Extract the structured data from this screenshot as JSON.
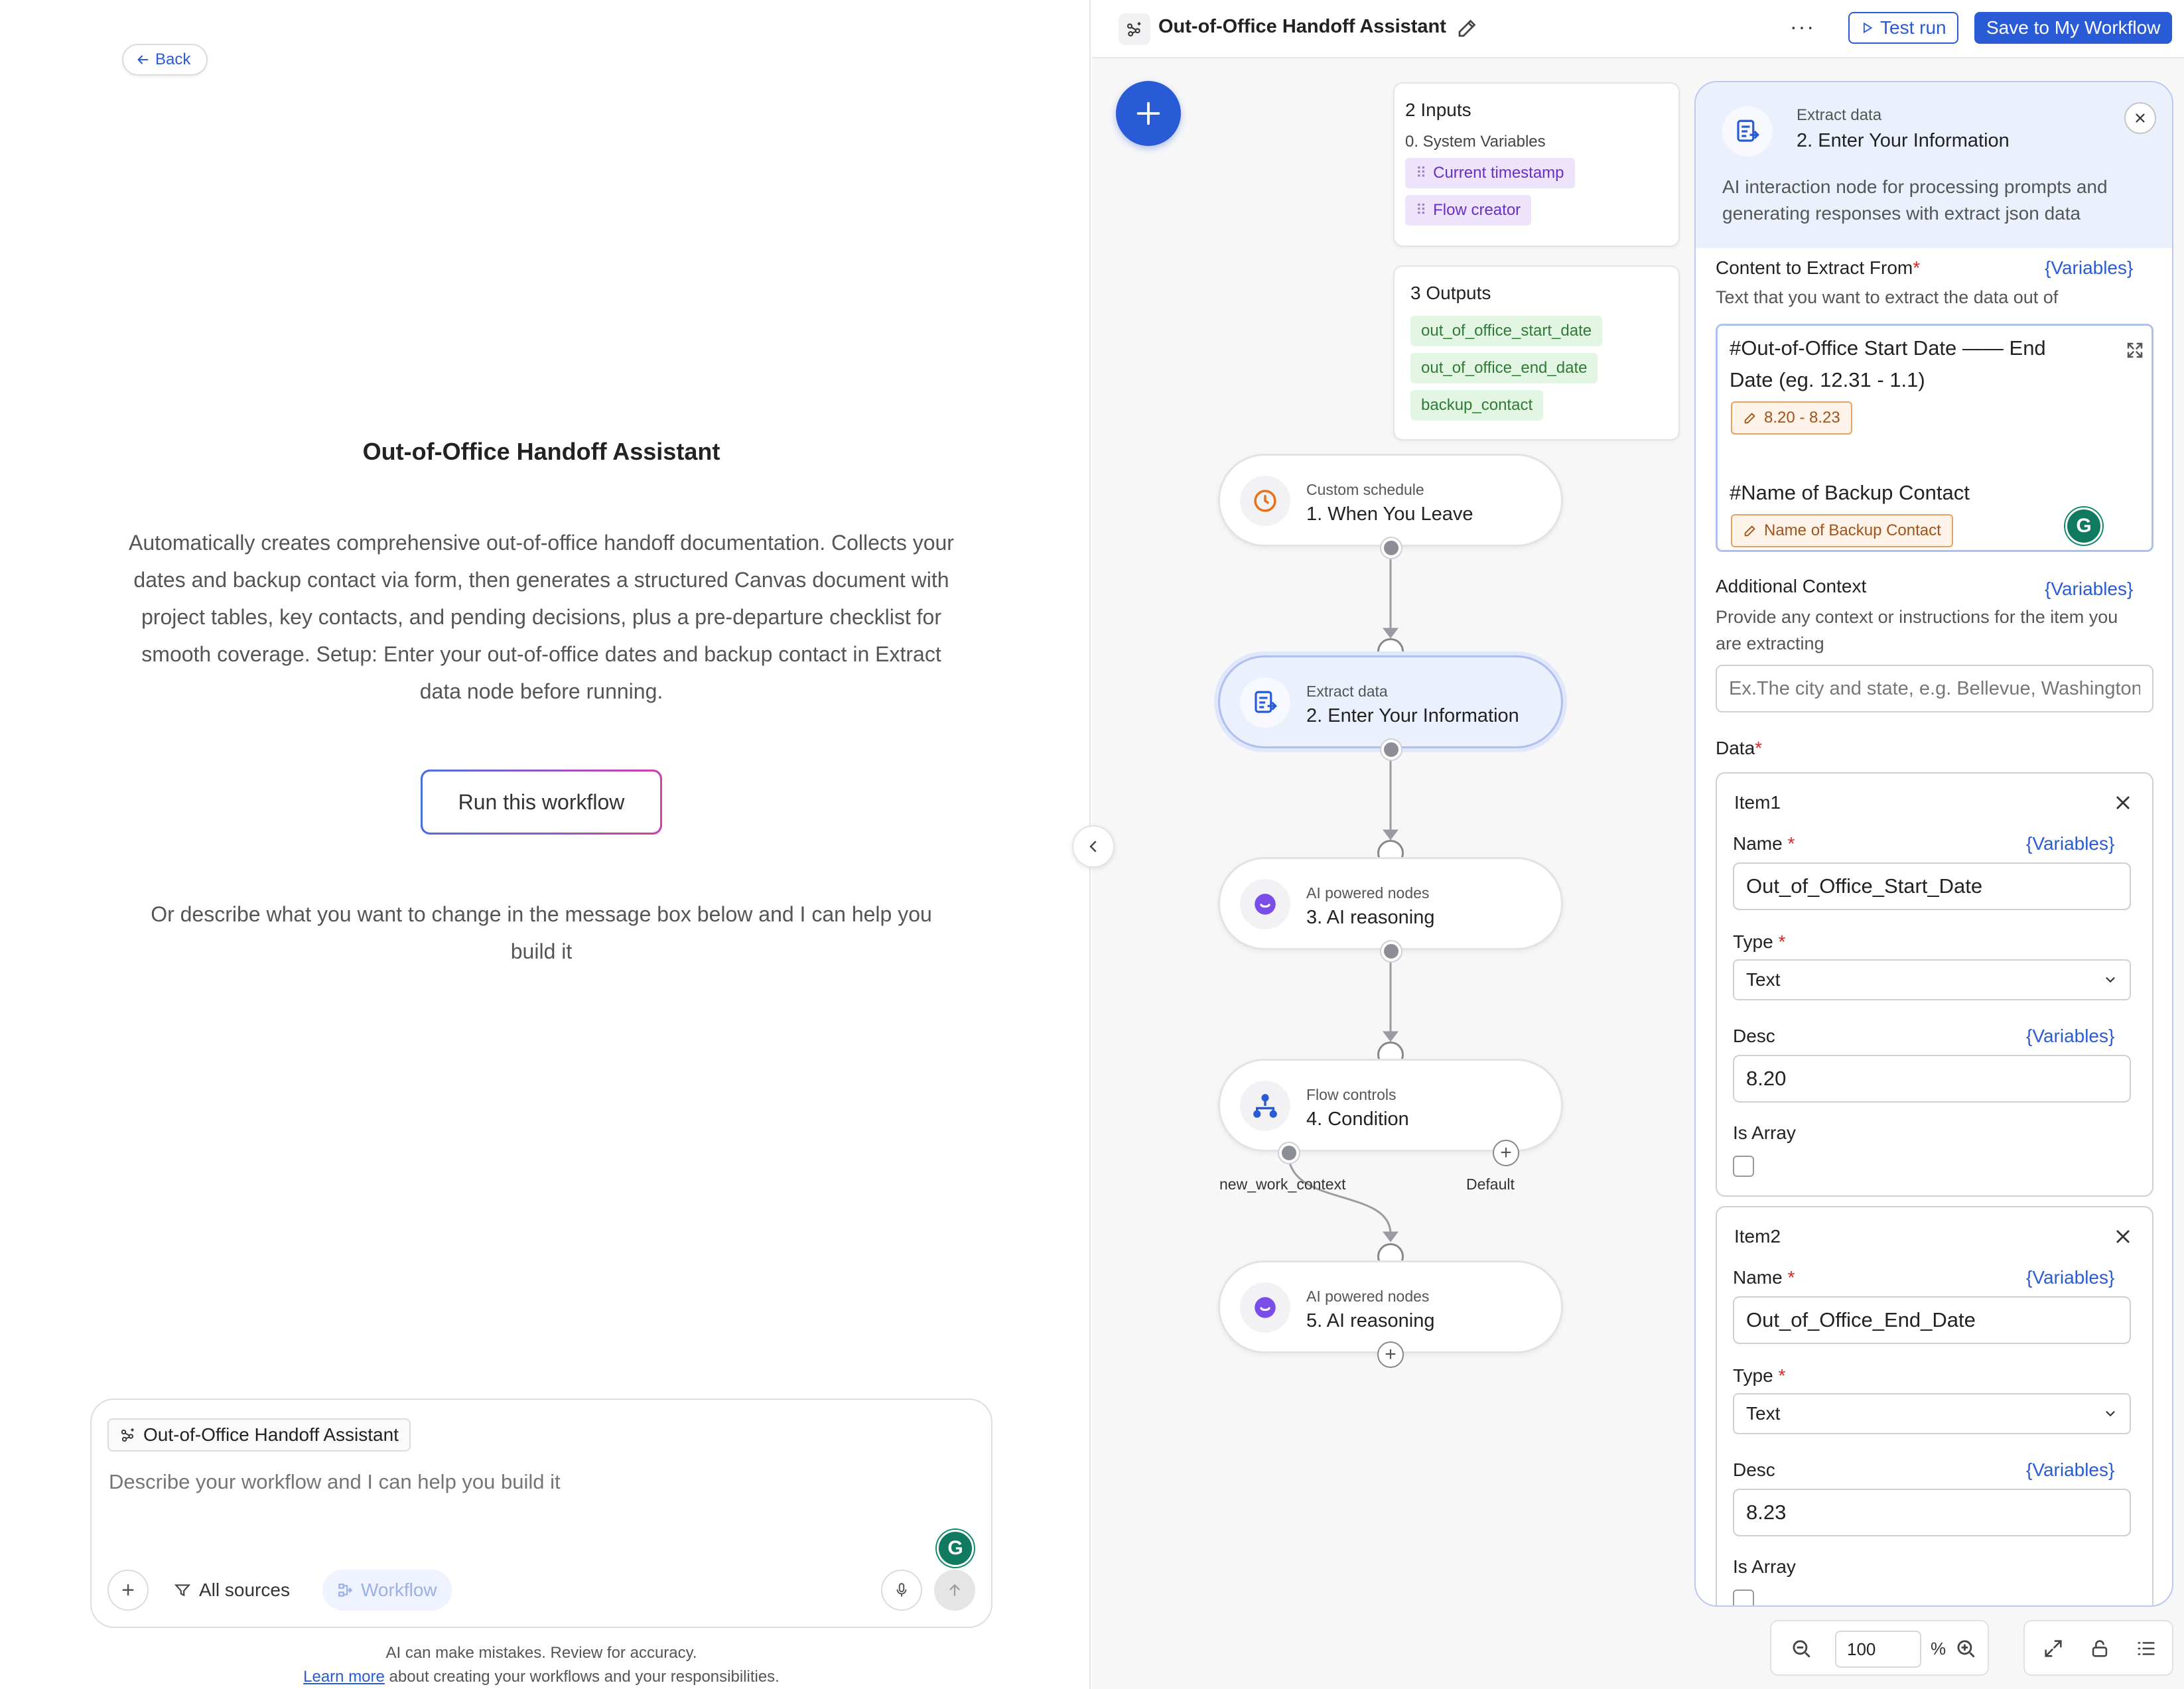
{
  "left": {
    "back_label": "Back",
    "title": "Out-of-Office Handoff Assistant",
    "description": "Automatically creates comprehensive out-of-office handoff documentation. Collects your dates and backup contact via form, then generates a structured Canvas document with project tables, key contacts, and pending decisions, plus a pre-departure checklist for smooth coverage. Setup: Enter your out-of-office dates and backup contact in Extract data node before running.",
    "run_button": "Run this workflow",
    "subtitle": "Or describe what you want to change in the message box below and I can help you build it",
    "composer": {
      "chip_label": "Out-of-Office Handoff Assistant",
      "placeholder": "Describe your workflow and I can help you build it",
      "sources_label": "All sources",
      "workflow_label": "Workflow"
    },
    "disclaimer_line1": "AI can make mistakes. Review for accuracy.",
    "learn_more": "Learn more",
    "disclaimer_line2": "about creating your workflows and your responsibilities."
  },
  "header": {
    "title": "Out-of-Office Handoff Assistant",
    "more": "···",
    "test_run": "Test run",
    "save": "Save to My Workflow"
  },
  "inputs_card": {
    "title": "2 Inputs",
    "group": "0. System Variables",
    "tags": [
      "Current timestamp",
      "Flow creator"
    ]
  },
  "outputs_card": {
    "title": "3 Outputs",
    "tags": [
      "out_of_office_start_date",
      "out_of_office_end_date",
      "backup_contact"
    ]
  },
  "nodes": [
    {
      "category": "Custom schedule",
      "name": "1. When You Leave",
      "icon": "clock-icon",
      "color": "#e8701a"
    },
    {
      "category": "Extract data",
      "name": "2. Enter Your Information",
      "icon": "extract-icon",
      "color": "#2a5bd7"
    },
    {
      "category": "AI powered nodes",
      "name": "3. AI reasoning",
      "icon": "ai-bubble-icon",
      "color": "#7b4de8"
    },
    {
      "category": "Flow controls",
      "name": "4. Condition",
      "icon": "branch-icon",
      "color": "#2a5bd7"
    },
    {
      "category": "AI powered nodes",
      "name": "5. AI reasoning",
      "icon": "ai-bubble-icon",
      "color": "#7b4de8"
    }
  ],
  "condition_branches": [
    "new_work_context",
    "Default"
  ],
  "panel": {
    "category": "Extract data",
    "name": "2. Enter Your Information",
    "description": "AI interaction node for processing prompts and generating responses with extract json data",
    "variables_label": "{Variables}",
    "content_label": "Content to Extract From",
    "content_help": "Text that you want to extract the data out of",
    "content_line1": "#Out-of-Office Start Date —— End",
    "content_line2": "Date (eg. 12.31 - 1.1)",
    "content_chip1": "8.20 - 8.23",
    "content_line3": "#Name of Backup Contact",
    "content_chip2": "Name of Backup Contact",
    "context_label": "Additional Context",
    "context_help": "Provide any context or instructions for the item you are extracting",
    "context_placeholder": "Ex.The city and state, e.g. Bellevue, Washington",
    "data_label": "Data",
    "items": [
      {
        "title": "Item1",
        "name_label": "Name",
        "name_value": "Out_of_Office_Start_Date",
        "type_label": "Type",
        "type_value": "Text",
        "desc_label": "Desc",
        "desc_value": "8.20",
        "array_label": "Is Array"
      },
      {
        "title": "Item2",
        "name_label": "Name",
        "name_value": "Out_of_Office_End_Date",
        "type_label": "Type",
        "type_value": "Text",
        "desc_label": "Desc",
        "desc_value": "8.23",
        "array_label": "Is Array"
      }
    ]
  },
  "zoom": {
    "value": "100",
    "unit": "%"
  },
  "colors": {
    "accent": "#2a5bd7",
    "active_node_bg": "#eaf0fc",
    "input_tag_bg": "#ede3fb",
    "output_tag_bg": "#e3f6e3"
  }
}
